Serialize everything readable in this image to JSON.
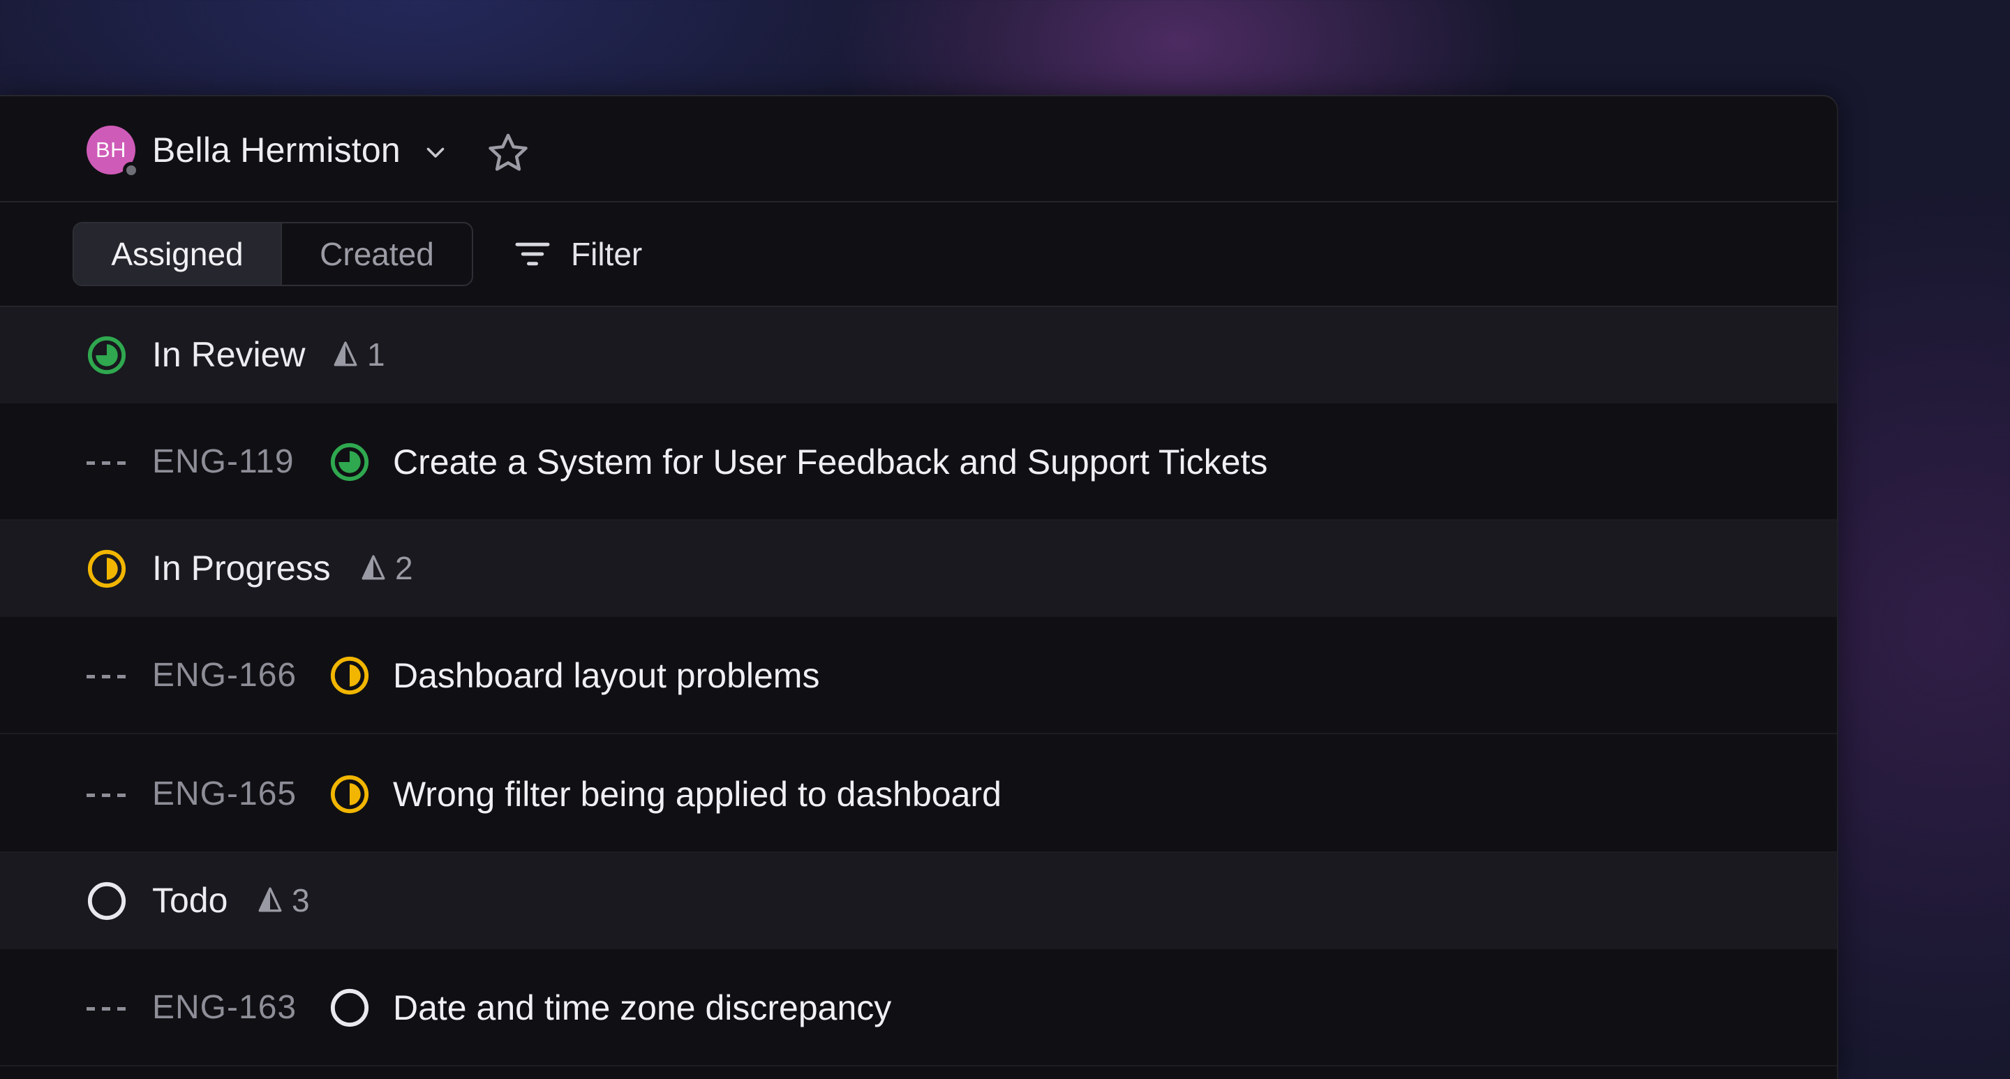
{
  "user": {
    "initials": "BH",
    "name": "Bella Hermiston"
  },
  "tabs": {
    "assigned": "Assigned",
    "created": "Created",
    "active": "assigned"
  },
  "filter_label": "Filter",
  "colors": {
    "in_review": "#2fa84f",
    "in_progress": "#f2b600",
    "todo": "#e8e8ee",
    "avatar": "#cf5bb8"
  },
  "groups": [
    {
      "status": "In Review",
      "icon": "in-review-icon",
      "count": "1",
      "issues": [
        {
          "priority": "---",
          "id": "ENG-119",
          "title": "Create a System for User Feedback and Support Tickets"
        }
      ]
    },
    {
      "status": "In Progress",
      "icon": "in-progress-icon",
      "count": "2",
      "issues": [
        {
          "priority": "---",
          "id": "ENG-166",
          "title": "Dashboard layout problems"
        },
        {
          "priority": "---",
          "id": "ENG-165",
          "title": "Wrong filter being applied to dashboard"
        }
      ]
    },
    {
      "status": "Todo",
      "icon": "todo-icon",
      "count": "3",
      "issues": [
        {
          "priority": "---",
          "id": "ENG-163",
          "title": "Date and time zone discrepancy"
        }
      ]
    }
  ]
}
